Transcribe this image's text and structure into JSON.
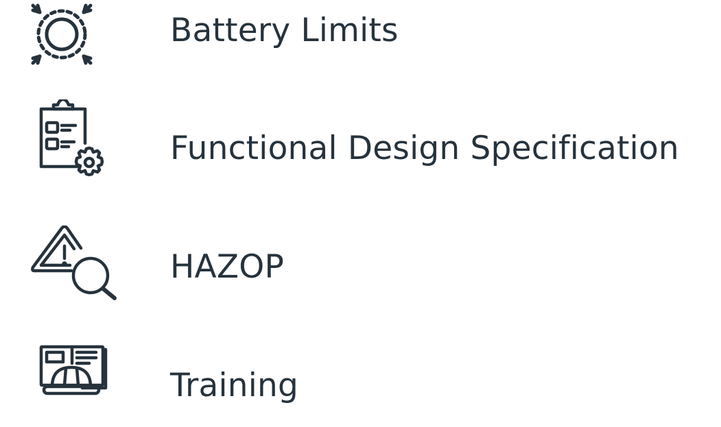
{
  "services": {
    "items": [
      {
        "icon": "battery-limits-icon",
        "label": "Battery Limits"
      },
      {
        "icon": "functional-spec-icon",
        "label": "Functional Design Specification"
      },
      {
        "icon": "hazop-icon",
        "label": "HAZOP"
      },
      {
        "icon": "training-icon",
        "label": "Training"
      }
    ]
  },
  "colors": {
    "text": "#26333d",
    "icon_stroke": "#26333d",
    "background": "#ffffff"
  }
}
